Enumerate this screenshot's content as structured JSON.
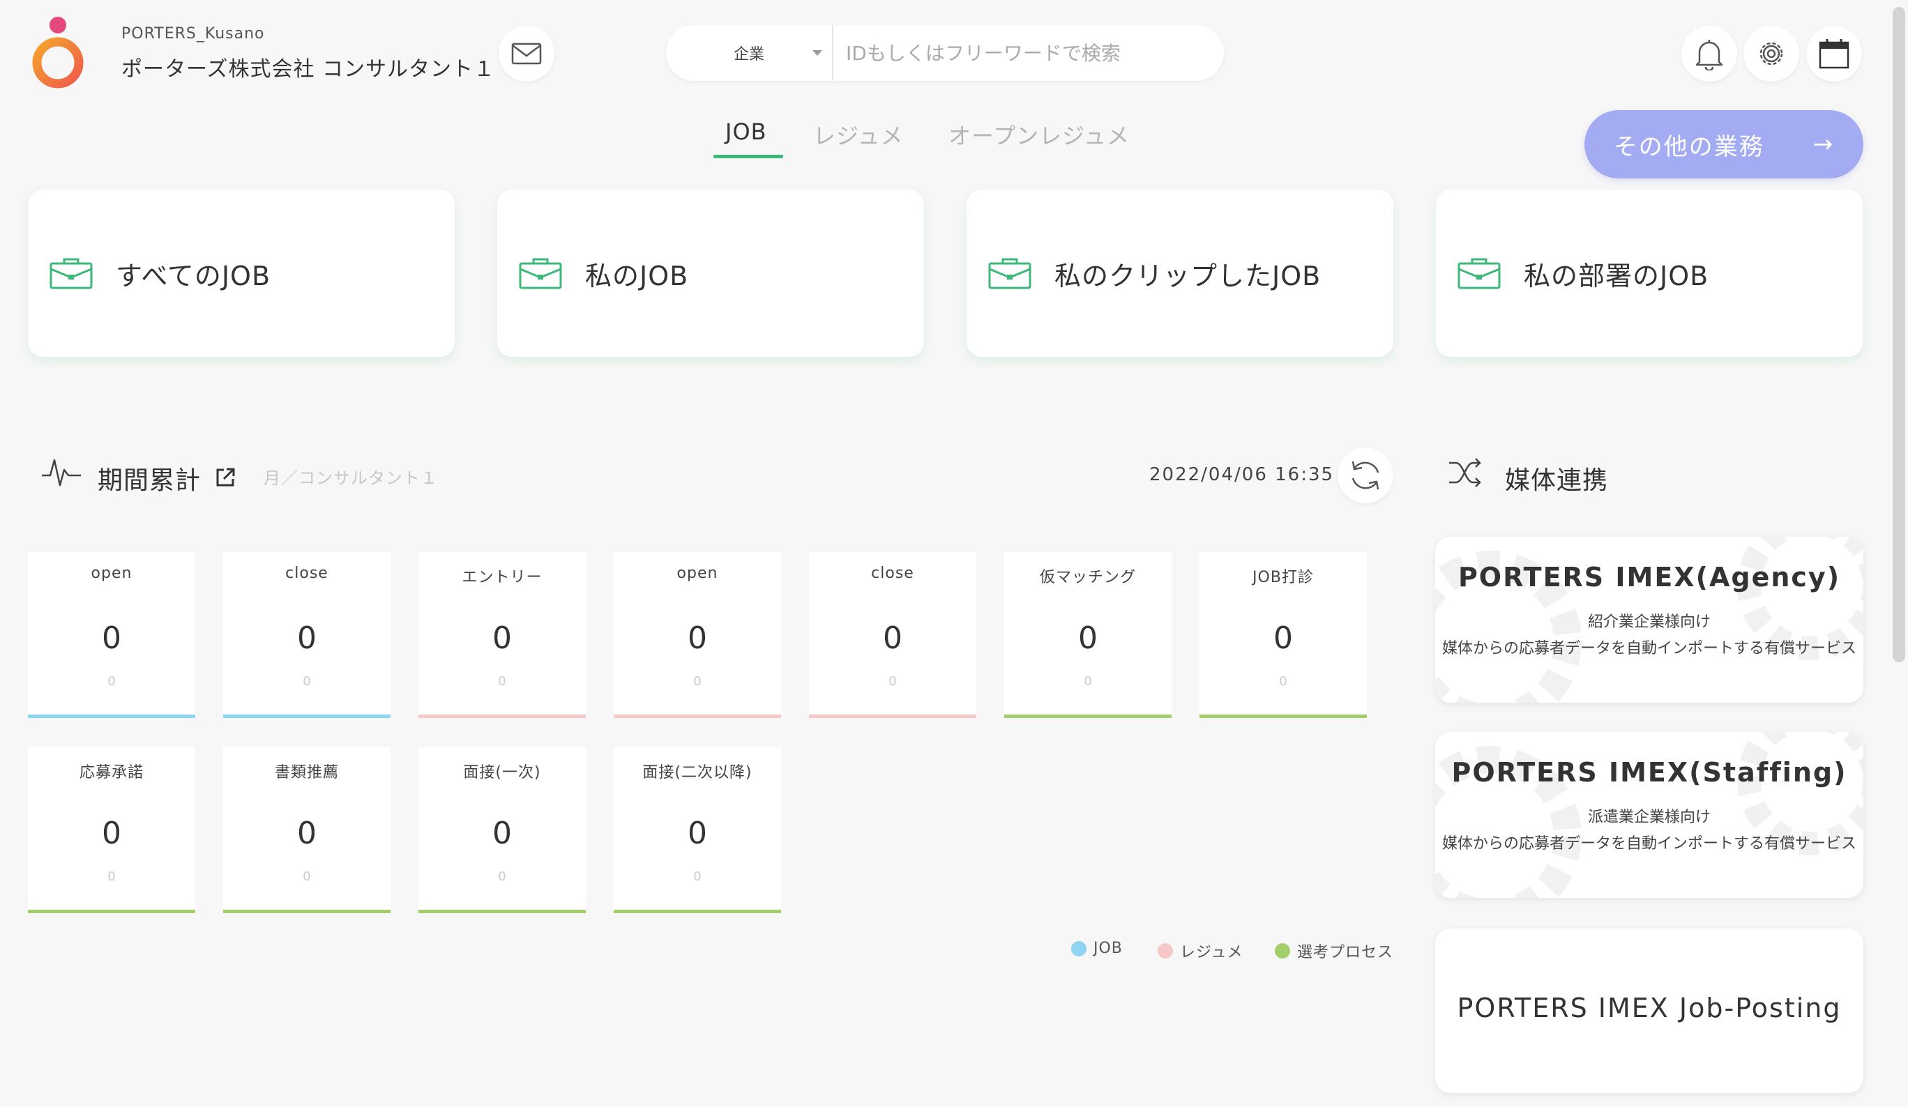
{
  "header": {
    "company_code": "PORTERS_Kusano",
    "company_name": "ポーターズ株式会社 コンサルタント１",
    "search": {
      "category": "企業",
      "placeholder": "IDもしくはフリーワードで検索"
    }
  },
  "tabs": [
    {
      "label": "JOB",
      "active": true
    },
    {
      "label": "レジュメ",
      "active": false
    },
    {
      "label": "オープンレジュメ",
      "active": false
    }
  ],
  "other_button": {
    "label": "その他の業務",
    "arrow": "→"
  },
  "job_cards": [
    {
      "label": "すべてのJOB",
      "icon": "briefcase-icon"
    },
    {
      "label": "私のJOB",
      "icon": "briefcase-icon"
    },
    {
      "label": "私のクリップしたJOB",
      "icon": "briefcase-icon"
    },
    {
      "label": "私の部署のJOB",
      "icon": "briefcase-icon"
    }
  ],
  "period": {
    "title": "期間累計",
    "subtitle": "月／コンサルタント１",
    "timestamp": "2022/04/06 16:35"
  },
  "stats_row1": [
    {
      "label": "open",
      "value": "0",
      "sub": "0",
      "category": "job"
    },
    {
      "label": "close",
      "value": "0",
      "sub": "0",
      "category": "job"
    },
    {
      "label": "エントリー",
      "value": "0",
      "sub": "0",
      "category": "resume"
    },
    {
      "label": "open",
      "value": "0",
      "sub": "0",
      "category": "resume"
    },
    {
      "label": "close",
      "value": "0",
      "sub": "0",
      "category": "resume"
    },
    {
      "label": "仮マッチング",
      "value": "0",
      "sub": "0",
      "category": "process"
    },
    {
      "label": "JOB打診",
      "value": "0",
      "sub": "0",
      "category": "process"
    }
  ],
  "stats_row2": [
    {
      "label": "応募承諾",
      "value": "0",
      "sub": "0",
      "category": "process"
    },
    {
      "label": "書類推薦",
      "value": "0",
      "sub": "0",
      "category": "process"
    },
    {
      "label": "面接(一次)",
      "value": "0",
      "sub": "0",
      "category": "process"
    },
    {
      "label": "面接(二次以降)",
      "value": "0",
      "sub": "0",
      "category": "process"
    }
  ],
  "legend": [
    {
      "label": "JOB",
      "color": "#8fd5f1"
    },
    {
      "label": "レジュメ",
      "color": "#f6c8c8"
    },
    {
      "label": "選考プロセス",
      "color": "#a3cf6b"
    }
  ],
  "media": {
    "title": "媒体連携",
    "cards": [
      {
        "title": "PORTERS IMEX(Agency)",
        "sub": "紹介業企業様向け",
        "desc": "媒体からの応募者データを自動インポートする有償サービス"
      },
      {
        "title": "PORTERS IMEX(Staffing)",
        "sub": "派遣業企業様向け",
        "desc": "媒体からの応募者データを自動インポートする有償サービス"
      },
      {
        "title": "PORTERS IMEX Job-Posting"
      }
    ]
  },
  "colors": {
    "accent_green": "#3cb878",
    "button_purple": "#a3abf3"
  }
}
